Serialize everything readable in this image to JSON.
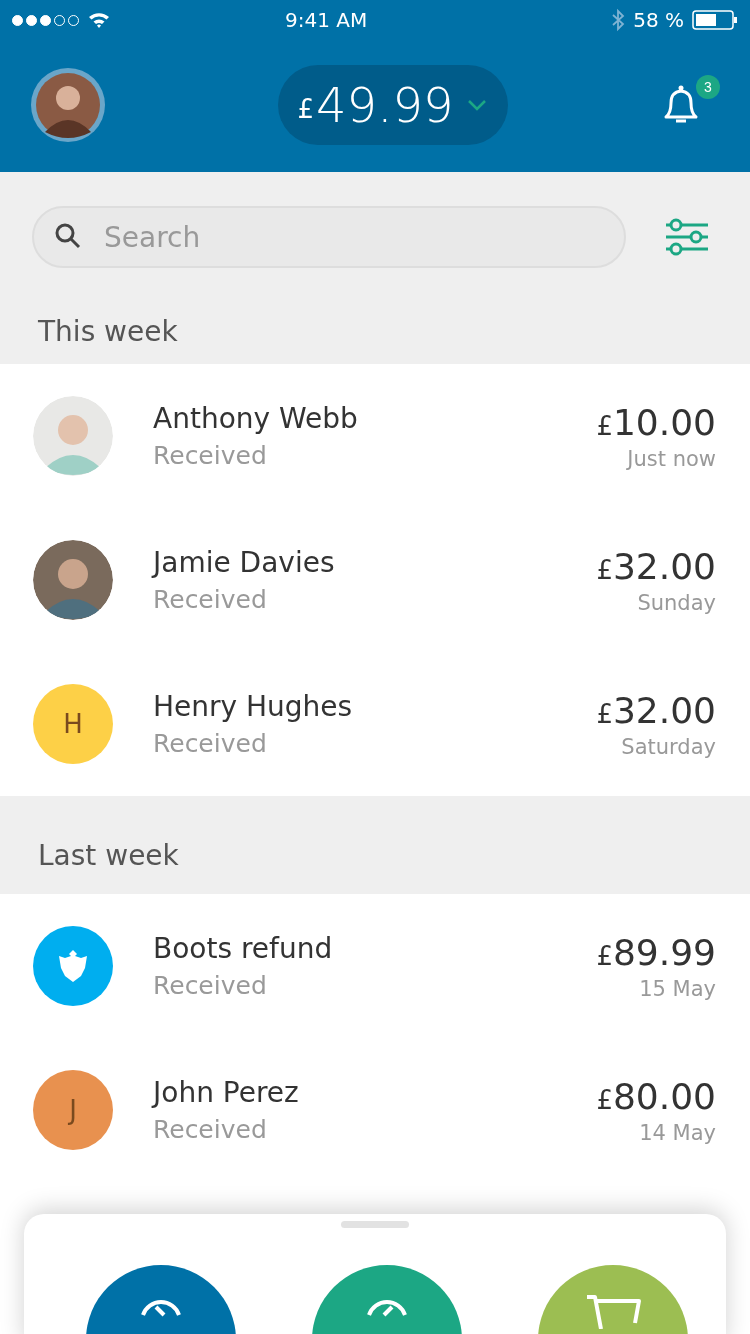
{
  "status_bar": {
    "time": "9:41 AM",
    "battery": "58 %"
  },
  "header": {
    "balance_currency": "£",
    "balance": "49.99",
    "notifications": "3"
  },
  "search": {
    "placeholder": "Search"
  },
  "sections": [
    {
      "title": "This week",
      "items": [
        {
          "name": "Anthony Webb",
          "status": "Received",
          "currency": "£",
          "amount": "10.00",
          "time": "Just now"
        },
        {
          "name": "Jamie Davies",
          "status": "Received",
          "currency": "£",
          "amount": "32.00",
          "time": "Sunday"
        },
        {
          "kind": "initial",
          "initial": "H",
          "color": "#fdd047",
          "name": "Henry Hughes",
          "status": "Received",
          "currency": "£",
          "amount": "32.00",
          "time": "Saturday"
        }
      ]
    },
    {
      "title": "Last week",
      "items": [
        {
          "kind": "logo",
          "color": "#00aeef",
          "name": "Boots refund",
          "status": "Received",
          "currency": "£",
          "amount": "89.99",
          "time": "15 May"
        },
        {
          "kind": "initial",
          "initial": "J",
          "color": "#e8914f",
          "name": "John Perez",
          "status": "Received",
          "currency": "£",
          "amount": "80.00",
          "time": "14 May"
        }
      ]
    }
  ],
  "actions": [
    {
      "kind": "history",
      "color": "#0071a7"
    },
    {
      "kind": "send",
      "color": "#1ca784"
    },
    {
      "kind": "shop",
      "color": "#9cbe52"
    }
  ]
}
